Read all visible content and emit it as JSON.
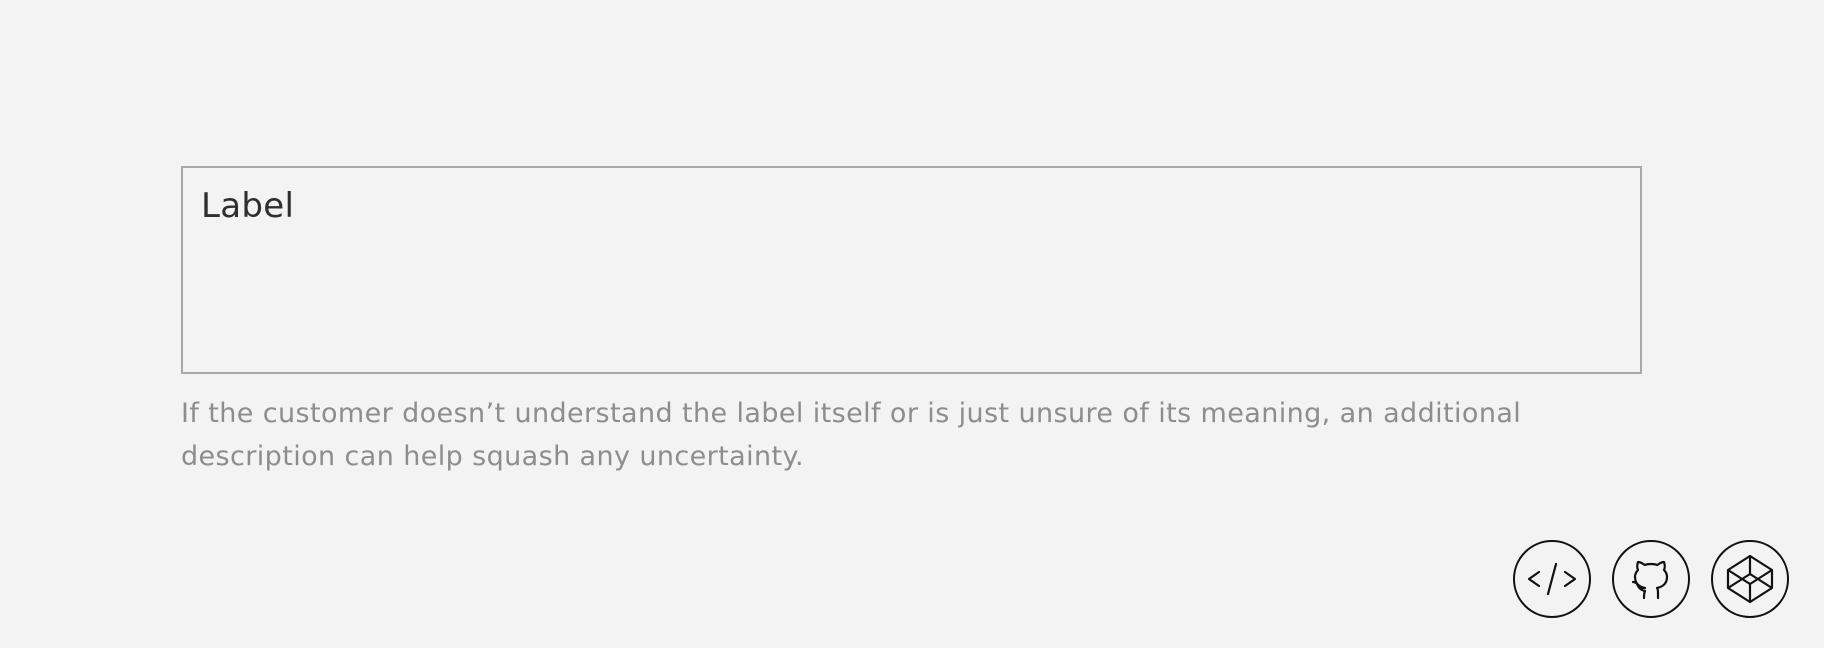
{
  "form": {
    "label": "Label",
    "value": "",
    "description": "If the customer doesn’t understand the label itself or is just unsure of its meaning, an additional description can help squash any uncertainty."
  },
  "footer_links": {
    "items": [
      {
        "icon": "code-icon"
      },
      {
        "icon": "github-icon"
      },
      {
        "icon": "codepen-icon"
      }
    ]
  },
  "colors": {
    "background": "#f3f3f3",
    "field_border": "#a8a8a8",
    "label_text": "#2f2f2f",
    "description_text": "#8d8d8d",
    "icon_stroke": "#111111"
  }
}
